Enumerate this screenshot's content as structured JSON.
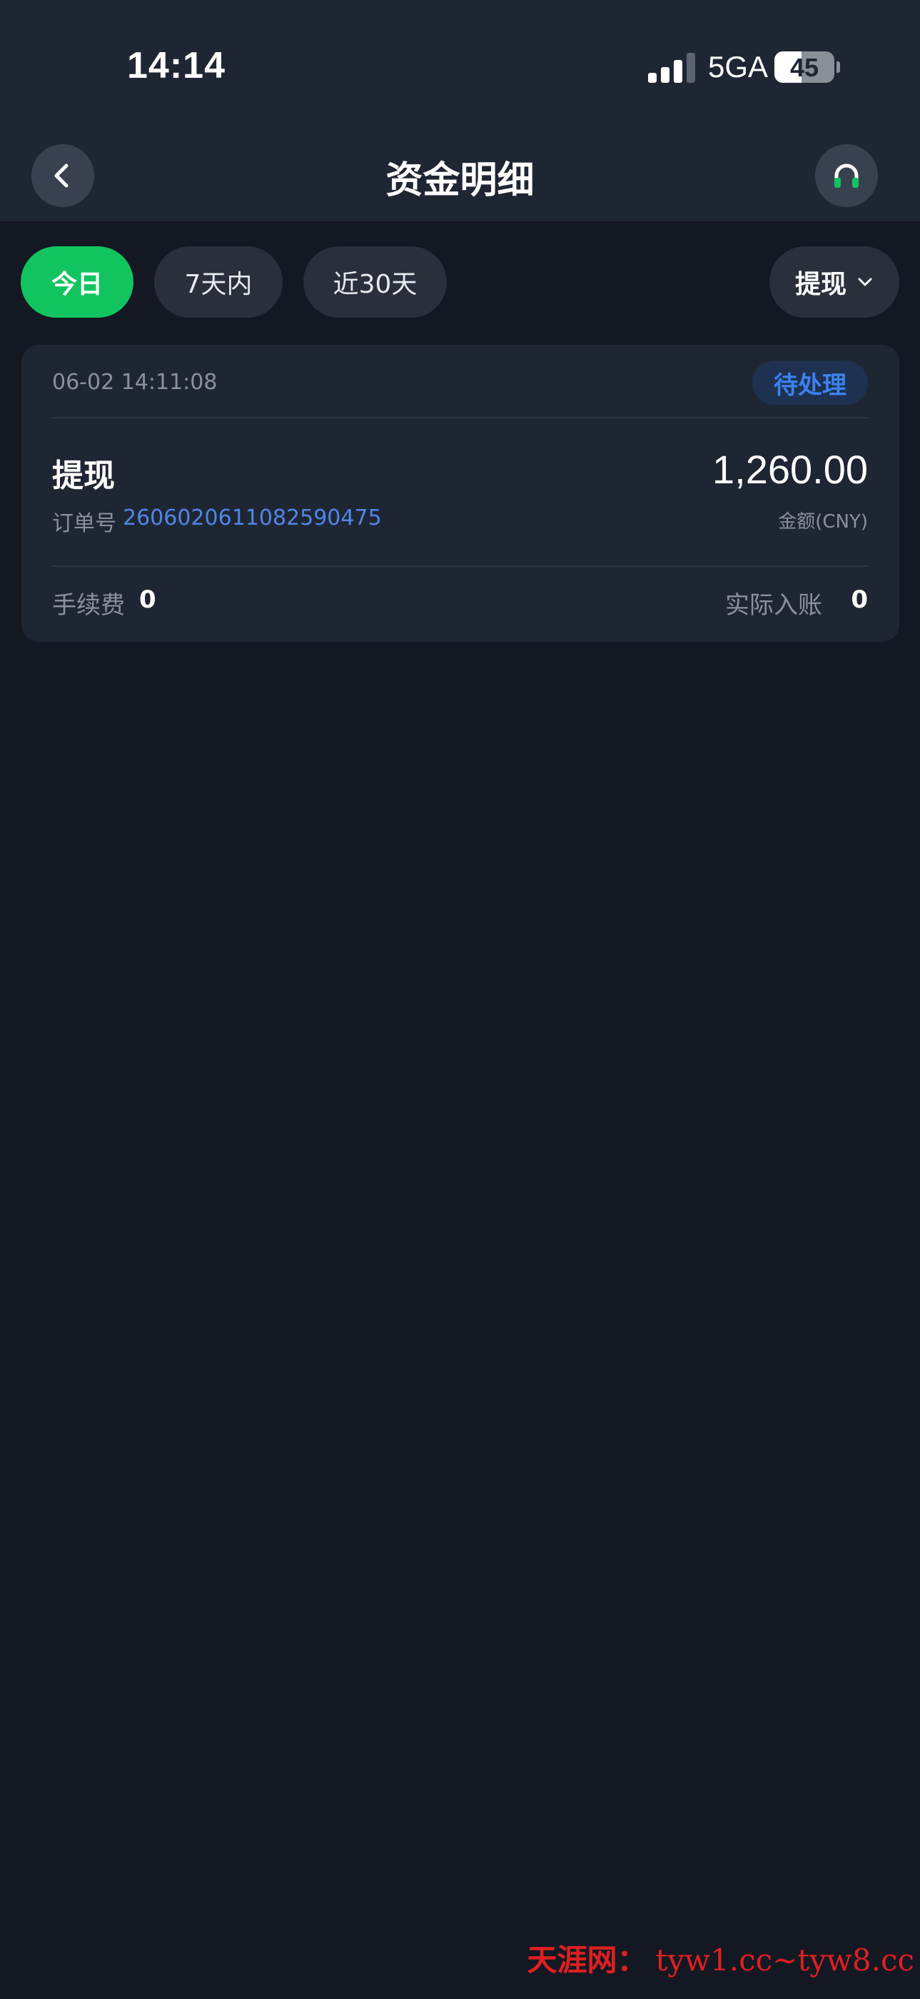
{
  "status_bar": {
    "time": "14:14",
    "network": "5GA",
    "battery": "45"
  },
  "header": {
    "title": "资金明细"
  },
  "filters": {
    "today": "今日",
    "last_7_days": "7天内",
    "last_30_days": "近30天",
    "type_select": "提现"
  },
  "record": {
    "time": "06-02 14:11:08",
    "status": "待处理",
    "type": "提现",
    "order_label": "订单号",
    "order_no": "2606020611082590475",
    "amount": "1,260.00",
    "amount_label": "金额(CNY)",
    "fee_label": "手续费",
    "fee_value": "0",
    "actual_label": "实际入账",
    "actual_value": "0"
  },
  "watermark": {
    "brand": "天涯网：",
    "text": "tyw1.cc~tyw8.cc"
  },
  "colors": {
    "accent_green": "#12c45f",
    "status_blue": "#3b82f0",
    "order_link": "#4f86e8",
    "background": "#131823",
    "card": "#1f2633"
  }
}
